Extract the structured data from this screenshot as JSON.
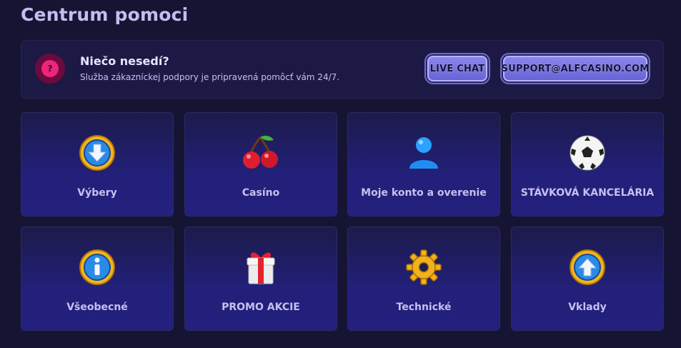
{
  "page": {
    "title": "Centrum pomoci"
  },
  "banner": {
    "icon": "question-icon",
    "icon_glyph": "?",
    "title": "Niečo nesedí?",
    "subtitle": "Služba zákazníckej podpory je pripravená pomôcť vám 24/7.",
    "buttons": {
      "live_chat": "LIVE CHAT",
      "email": "SUPPORT@ALFCASINO.COM"
    }
  },
  "categories": [
    {
      "label": "Výbery",
      "icon": "download-arrow-icon"
    },
    {
      "label": "Casíno",
      "icon": "cherries-icon"
    },
    {
      "label": "Moje konto a overenie",
      "icon": "user-icon"
    },
    {
      "label": "STÁVKOVÁ KANCELÁRIA",
      "icon": "soccer-ball-icon"
    },
    {
      "label": "Všeobecné",
      "icon": "info-icon"
    },
    {
      "label": "PROMO AKCIE",
      "icon": "gift-icon"
    },
    {
      "label": "Technické",
      "icon": "gear-icon"
    },
    {
      "label": "Vklady",
      "icon": "upload-arrow-icon"
    }
  ],
  "colors": {
    "background": "#161433",
    "accent": "#7b74e6",
    "alert": "#f0237a"
  }
}
